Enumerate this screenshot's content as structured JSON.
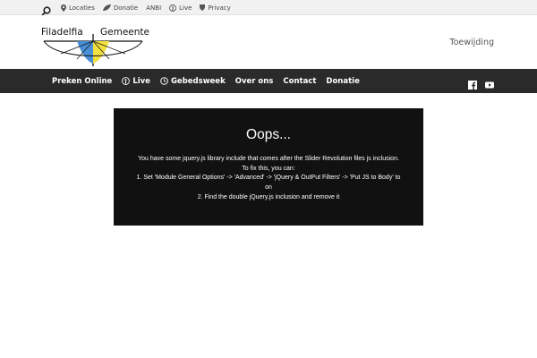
{
  "topbar": {
    "search_icon": "search-icon",
    "links": [
      {
        "label": "Locaties",
        "icon": "map-pin-icon"
      },
      {
        "label": "Donatie",
        "icon": "leaf-icon"
      },
      {
        "label": "ANBI",
        "icon": ""
      },
      {
        "label": "Live",
        "icon": "broadcast-icon"
      },
      {
        "label": "Privacy",
        "icon": "shield-icon"
      }
    ]
  },
  "header": {
    "logo_left": "Filadelfia",
    "logo_right": "Gemeente",
    "right_link": "Toewijding",
    "colors": {
      "blue": "#4a8fd6",
      "yellow": "#f2e040"
    }
  },
  "nav": {
    "items": [
      {
        "label": "Preken Online",
        "icon": ""
      },
      {
        "label": "Live",
        "icon": "broadcast-icon"
      },
      {
        "label": "Gebedsweek",
        "icon": "clock-icon"
      },
      {
        "label": "Over ons",
        "icon": ""
      },
      {
        "label": "Contact",
        "icon": ""
      },
      {
        "label": "Donatie",
        "icon": ""
      }
    ],
    "social": [
      "facebook-icon",
      "youtube-icon"
    ]
  },
  "error": {
    "title": "Oops...",
    "lines": [
      "You have some jquery.js library include that comes after the Slider Revolution files js inclusion.",
      "To fix this, you can:",
      "1. Set 'Module General Options' -> 'Advanced' -> 'jQuery & OutPut Filters' -> 'Put JS to Body' to",
      "on",
      "2. Find the double jQuery.js inclusion and remove it"
    ]
  }
}
